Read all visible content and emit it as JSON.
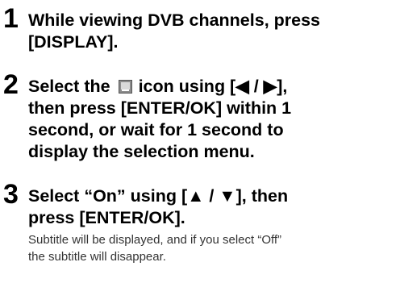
{
  "steps": [
    {
      "number": "1",
      "line1": "While viewing DVB channels, press",
      "line2": "[DISPLAY]."
    },
    {
      "number": "2",
      "line1_before": "Select the",
      "icon": "subtitle-icon",
      "line1_after": "icon using [◀ / ▶],",
      "line2": "then press [ENTER/OK] within 1",
      "line3": "second, or wait for 1 second to",
      "line4": "display the selection menu."
    },
    {
      "number": "3",
      "line1": "Select “On” using [▲ / ▼], then",
      "line2": "press [ENTER/OK].",
      "note_line1": "Subtitle will be displayed, and if you select “Off”",
      "note_line2": "the subtitle will disappear."
    }
  ]
}
